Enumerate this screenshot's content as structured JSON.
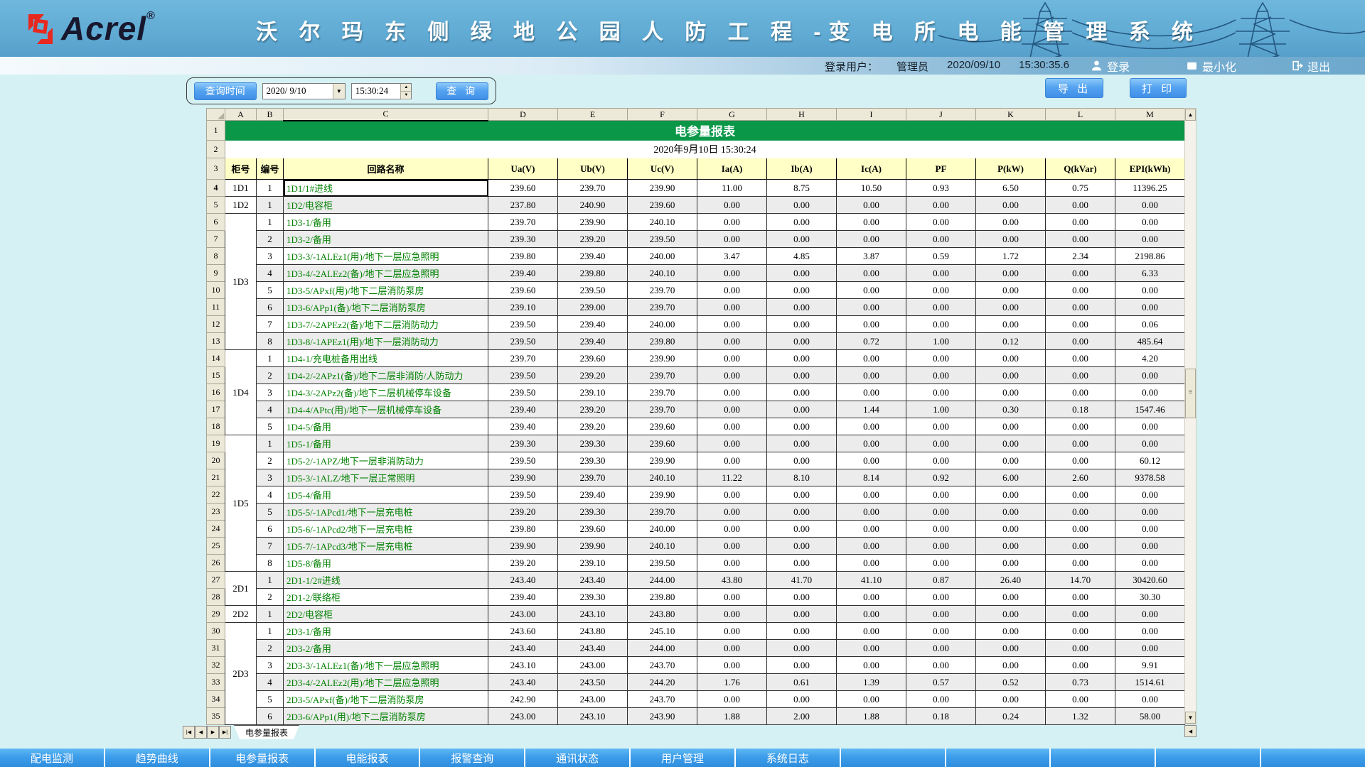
{
  "header": {
    "logo_text": "Acrel",
    "logo_reg": "®",
    "title": "沃 尔 玛 东 侧 绿 地 公 园 人 防 工 程 -变 电 所 电 能 管 理 系 统"
  },
  "loginbar": {
    "user_label": "登录用户：",
    "user_name": "管理员",
    "date": "2020/09/10",
    "time": "15:30:35.6",
    "login_label": "登录",
    "minimize_label": "最小化",
    "exit_label": "退出"
  },
  "toolbar": {
    "query_time_label": "查询时间",
    "date_value": "2020/ 9/10",
    "time_value": "15:30:24",
    "query_label": "查 询",
    "export_label": "导 出",
    "print_label": "打 印"
  },
  "glyphs": {
    "up": "▲",
    "down": "▼",
    "left": "◀",
    "right": "▶",
    "dropdown": "▼",
    "first": "|◀",
    "prev": "◀",
    "next": "▶",
    "last": "▶|"
  },
  "sheet": {
    "column_letters": [
      "A",
      "B",
      "C",
      "D",
      "E",
      "F",
      "G",
      "H",
      "I",
      "J",
      "K",
      "L",
      "M"
    ],
    "selected_column": "C",
    "title": "电参量报表",
    "subtitle": "2020年9月10日 15:30:24",
    "headers": [
      "柜号",
      "编号",
      "回路名称",
      "Ua(V)",
      "Ub(V)",
      "Uc(V)",
      "Ia(A)",
      "Ib(A)",
      "Ic(A)",
      "PF",
      "P(kW)",
      "Q(kVar)",
      "EPI(kWh)"
    ],
    "tab_name": "电参量报表",
    "rows": [
      {
        "row": 4,
        "cabinet": "1D1",
        "span": 1,
        "no": "1",
        "name": "1D1/1#进线",
        "selected": true,
        "values": [
          "239.60",
          "239.70",
          "239.90",
          "11.00",
          "8.75",
          "10.50",
          "0.93",
          "6.50",
          "0.75",
          "11396.25"
        ]
      },
      {
        "row": 5,
        "cabinet": "1D2",
        "span": 1,
        "no": "1",
        "name": "1D2/电容柜",
        "values": [
          "237.80",
          "240.90",
          "239.60",
          "0.00",
          "0.00",
          "0.00",
          "0.00",
          "0.00",
          "0.00",
          "0.00"
        ]
      },
      {
        "row": 6,
        "cabinet": "1D3",
        "span": 8,
        "no": "1",
        "name": "1D3-1/备用",
        "values": [
          "239.70",
          "239.90",
          "240.10",
          "0.00",
          "0.00",
          "0.00",
          "0.00",
          "0.00",
          "0.00",
          "0.00"
        ]
      },
      {
        "row": 7,
        "no": "2",
        "name": "1D3-2/备用",
        "values": [
          "239.30",
          "239.20",
          "239.50",
          "0.00",
          "0.00",
          "0.00",
          "0.00",
          "0.00",
          "0.00",
          "0.00"
        ]
      },
      {
        "row": 8,
        "no": "3",
        "name": "1D3-3/-1ALEz1(用)/地下一层应急照明",
        "values": [
          "239.80",
          "239.40",
          "240.00",
          "3.47",
          "4.85",
          "3.87",
          "0.59",
          "1.72",
          "2.34",
          "2198.86"
        ]
      },
      {
        "row": 9,
        "no": "4",
        "name": "1D3-4/-2ALEz2(备)/地下二层应急照明",
        "values": [
          "239.40",
          "239.80",
          "240.10",
          "0.00",
          "0.00",
          "0.00",
          "0.00",
          "0.00",
          "0.00",
          "6.33"
        ]
      },
      {
        "row": 10,
        "no": "5",
        "name": "1D3-5/APxf(用)/地下二层消防泵房",
        "values": [
          "239.60",
          "239.50",
          "239.70",
          "0.00",
          "0.00",
          "0.00",
          "0.00",
          "0.00",
          "0.00",
          "0.00"
        ]
      },
      {
        "row": 11,
        "no": "6",
        "name": "1D3-6/APp1(备)/地下二层消防泵房",
        "values": [
          "239.10",
          "239.00",
          "239.70",
          "0.00",
          "0.00",
          "0.00",
          "0.00",
          "0.00",
          "0.00",
          "0.00"
        ]
      },
      {
        "row": 12,
        "no": "7",
        "name": "1D3-7/-2APEz2(备)/地下二层消防动力",
        "values": [
          "239.50",
          "239.40",
          "240.00",
          "0.00",
          "0.00",
          "0.00",
          "0.00",
          "0.00",
          "0.00",
          "0.06"
        ]
      },
      {
        "row": 13,
        "no": "8",
        "name": "1D3-8/-1APEz1(用)/地下一层消防动力",
        "values": [
          "239.50",
          "239.40",
          "239.80",
          "0.00",
          "0.00",
          "0.72",
          "1.00",
          "0.12",
          "0.00",
          "485.64"
        ]
      },
      {
        "row": 14,
        "cabinet": "1D4",
        "span": 5,
        "no": "1",
        "name": "1D4-1/充电桩备用出线",
        "values": [
          "239.70",
          "239.60",
          "239.90",
          "0.00",
          "0.00",
          "0.00",
          "0.00",
          "0.00",
          "0.00",
          "4.20"
        ]
      },
      {
        "row": 15,
        "no": "2",
        "name": "1D4-2/-2APz1(备)/地下二层非消防/人防动力",
        "values": [
          "239.50",
          "239.20",
          "239.70",
          "0.00",
          "0.00",
          "0.00",
          "0.00",
          "0.00",
          "0.00",
          "0.00"
        ]
      },
      {
        "row": 16,
        "no": "3",
        "name": "1D4-3/-2APz2(备)/地下二层机械停车设备",
        "values": [
          "239.50",
          "239.10",
          "239.70",
          "0.00",
          "0.00",
          "0.00",
          "0.00",
          "0.00",
          "0.00",
          "0.00"
        ]
      },
      {
        "row": 17,
        "no": "4",
        "name": "1D4-4/APtc(用)/地下一层机械停车设备",
        "values": [
          "239.40",
          "239.20",
          "239.70",
          "0.00",
          "0.00",
          "1.44",
          "1.00",
          "0.30",
          "0.18",
          "1547.46"
        ]
      },
      {
        "row": 18,
        "no": "5",
        "name": "1D4-5/备用",
        "values": [
          "239.40",
          "239.20",
          "239.60",
          "0.00",
          "0.00",
          "0.00",
          "0.00",
          "0.00",
          "0.00",
          "0.00"
        ]
      },
      {
        "row": 19,
        "cabinet": "1D5",
        "span": 8,
        "no": "1",
        "name": "1D5-1/备用",
        "values": [
          "239.30",
          "239.30",
          "239.60",
          "0.00",
          "0.00",
          "0.00",
          "0.00",
          "0.00",
          "0.00",
          "0.00"
        ]
      },
      {
        "row": 20,
        "no": "2",
        "name": "1D5-2/-1APZ/地下一层非消防动力",
        "values": [
          "239.50",
          "239.30",
          "239.90",
          "0.00",
          "0.00",
          "0.00",
          "0.00",
          "0.00",
          "0.00",
          "60.12"
        ]
      },
      {
        "row": 21,
        "no": "3",
        "name": "1D5-3/-1ALZ/地下一层正常照明",
        "values": [
          "239.90",
          "239.70",
          "240.10",
          "11.22",
          "8.10",
          "8.14",
          "0.92",
          "6.00",
          "2.60",
          "9378.58"
        ]
      },
      {
        "row": 22,
        "no": "4",
        "name": "1D5-4/备用",
        "values": [
          "239.50",
          "239.40",
          "239.90",
          "0.00",
          "0.00",
          "0.00",
          "0.00",
          "0.00",
          "0.00",
          "0.00"
        ]
      },
      {
        "row": 23,
        "no": "5",
        "name": "1D5-5/-1APcd1/地下一层充电桩",
        "values": [
          "239.20",
          "239.30",
          "239.70",
          "0.00",
          "0.00",
          "0.00",
          "0.00",
          "0.00",
          "0.00",
          "0.00"
        ]
      },
      {
        "row": 24,
        "no": "6",
        "name": "1D5-6/-1APcd2/地下一层充电桩",
        "values": [
          "239.80",
          "239.60",
          "240.00",
          "0.00",
          "0.00",
          "0.00",
          "0.00",
          "0.00",
          "0.00",
          "0.00"
        ]
      },
      {
        "row": 25,
        "no": "7",
        "name": "1D5-7/-1APcd3/地下一层充电桩",
        "values": [
          "239.90",
          "239.90",
          "240.10",
          "0.00",
          "0.00",
          "0.00",
          "0.00",
          "0.00",
          "0.00",
          "0.00"
        ]
      },
      {
        "row": 26,
        "no": "8",
        "name": "1D5-8/备用",
        "values": [
          "239.20",
          "239.10",
          "239.50",
          "0.00",
          "0.00",
          "0.00",
          "0.00",
          "0.00",
          "0.00",
          "0.00"
        ]
      },
      {
        "row": 27,
        "cabinet": "2D1",
        "span": 2,
        "no": "1",
        "name": "2D1-1/2#进线",
        "values": [
          "243.40",
          "243.40",
          "244.00",
          "43.80",
          "41.70",
          "41.10",
          "0.87",
          "26.40",
          "14.70",
          "30420.60"
        ]
      },
      {
        "row": 28,
        "no": "2",
        "name": "2D1-2/联络柜",
        "values": [
          "239.40",
          "239.30",
          "239.80",
          "0.00",
          "0.00",
          "0.00",
          "0.00",
          "0.00",
          "0.00",
          "30.30"
        ]
      },
      {
        "row": 29,
        "cabinet": "2D2",
        "span": 1,
        "no": "1",
        "name": "2D2/电容柜",
        "values": [
          "243.00",
          "243.10",
          "243.80",
          "0.00",
          "0.00",
          "0.00",
          "0.00",
          "0.00",
          "0.00",
          "0.00"
        ]
      },
      {
        "row": 30,
        "cabinet": "2D3",
        "span": 6,
        "no": "1",
        "name": "2D3-1/备用",
        "values": [
          "243.60",
          "243.80",
          "245.10",
          "0.00",
          "0.00",
          "0.00",
          "0.00",
          "0.00",
          "0.00",
          "0.00"
        ]
      },
      {
        "row": 31,
        "no": "2",
        "name": "2D3-2/备用",
        "values": [
          "243.40",
          "243.40",
          "244.00",
          "0.00",
          "0.00",
          "0.00",
          "0.00",
          "0.00",
          "0.00",
          "0.00"
        ]
      },
      {
        "row": 32,
        "no": "3",
        "name": "2D3-3/-1ALEz1(备)/地下一层应急照明",
        "values": [
          "243.10",
          "243.00",
          "243.70",
          "0.00",
          "0.00",
          "0.00",
          "0.00",
          "0.00",
          "0.00",
          "9.91"
        ]
      },
      {
        "row": 33,
        "no": "4",
        "name": "2D3-4/-2ALEz2(用)/地下二层应急照明",
        "values": [
          "243.40",
          "243.50",
          "244.20",
          "1.76",
          "0.61",
          "1.39",
          "0.57",
          "0.52",
          "0.73",
          "1514.61"
        ]
      },
      {
        "row": 34,
        "no": "5",
        "name": "2D3-5/APxf(备)/地下二层消防泵房",
        "values": [
          "242.90",
          "243.00",
          "243.70",
          "0.00",
          "0.00",
          "0.00",
          "0.00",
          "0.00",
          "0.00",
          "0.00"
        ]
      },
      {
        "row": 35,
        "no": "6",
        "name": "2D3-6/APp1(用)/地下二层消防泵房",
        "values": [
          "243.00",
          "243.10",
          "243.90",
          "1.88",
          "2.00",
          "1.88",
          "0.18",
          "0.24",
          "1.32",
          "58.00"
        ]
      }
    ]
  },
  "bottomnav": {
    "items": [
      "配电监测",
      "趋势曲线",
      "电参量报表",
      "电能报表",
      "报警查询",
      "通讯状态",
      "用户管理",
      "系统日志",
      "",
      "",
      "",
      "",
      ""
    ]
  },
  "colors": {
    "header_blue": "#60abd4",
    "pale_cyan": "#d5f1f3",
    "button_blue": "#3f8fe8",
    "banner_green": "#0a9748",
    "header_yellow": "#ffffc6",
    "row_alt_gray": "#ececec",
    "circuit_green": "#008000",
    "nav_blue": "#2e8ede"
  }
}
